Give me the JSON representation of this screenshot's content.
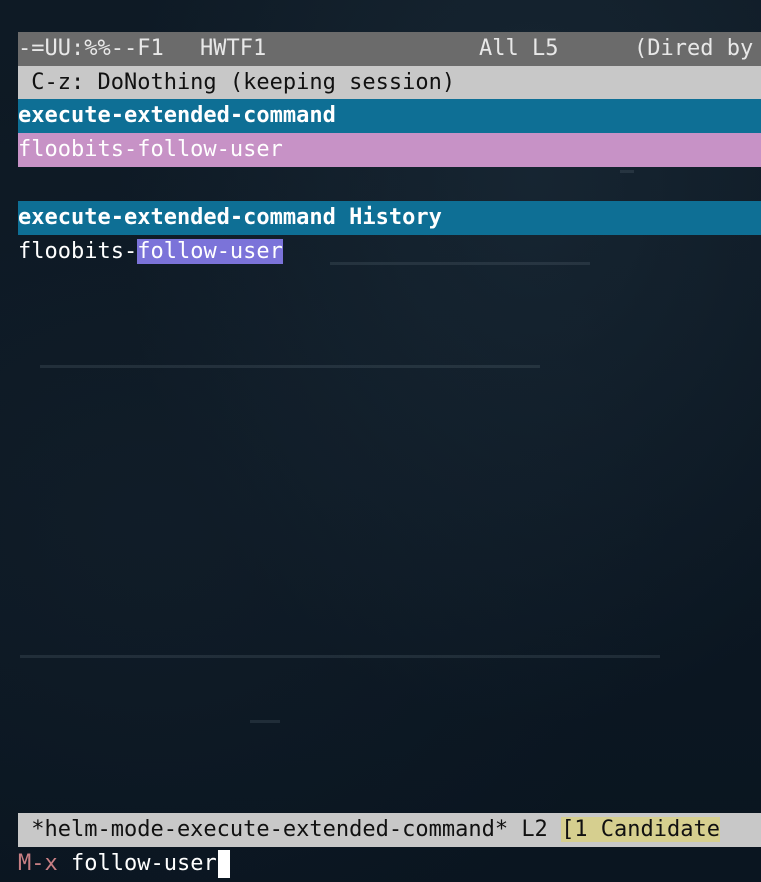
{
  "top_mode_line": {
    "status": "-=UU:%%--F1",
    "buffer": "HWTF1",
    "position": "All L5",
    "mode": "(Dired by"
  },
  "helm_header": {
    "text": " C-z: DoNothing (keeping session)"
  },
  "sources": [
    {
      "header": "execute-extended-command",
      "candidate": "floobits-follow-user"
    },
    {
      "header": "execute-extended-command History",
      "candidate_prefix": "floobits-",
      "candidate_match": "follow-user"
    }
  ],
  "bottom_mode_line": {
    "buffer": " *helm-mode-execute-extended-command* L2 ",
    "candidates": "[1 Candidate"
  },
  "minibuffer": {
    "prompt": "M-x",
    "input": "follow-user"
  },
  "colors": {
    "background": "#0b1722",
    "source_header": "#0e6f95",
    "selection": "#c792c6",
    "match": "#7b73d9",
    "prompt": "#c87f84",
    "candidate_count": "#d6cf8f"
  }
}
